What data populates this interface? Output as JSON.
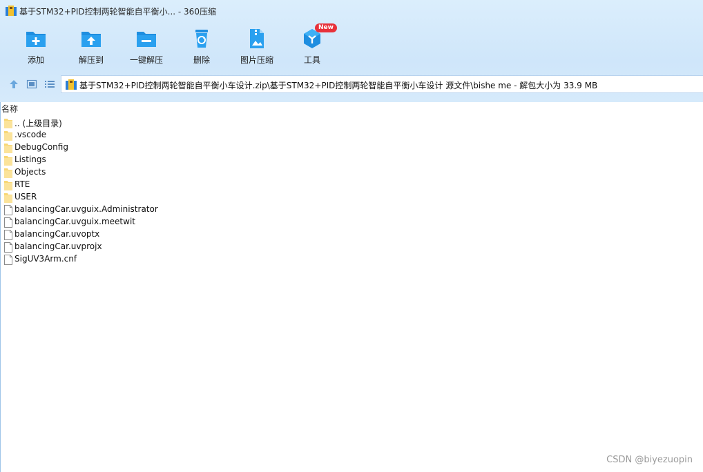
{
  "window": {
    "title": "基于STM32+PID控制两轮智能自平衡小... - 360压缩"
  },
  "toolbar": {
    "items": [
      {
        "label": "添加",
        "icon": "folder-add-icon"
      },
      {
        "label": "解压到",
        "icon": "folder-extract-icon"
      },
      {
        "label": "一键解压",
        "icon": "folder-minus-icon"
      },
      {
        "label": "删除",
        "icon": "recycle-bin-icon"
      },
      {
        "label": "图片压缩",
        "icon": "image-compress-icon"
      },
      {
        "label": "工具",
        "icon": "tools-cube-icon",
        "badge": "New"
      }
    ]
  },
  "nav": {
    "address": "基于STM32+PID控制两轮智能自平衡小车设计.zip\\基于STM32+PID控制两轮智能自平衡小车设计 源文件\\bishe me - 解包大小为 33.9 MB"
  },
  "list": {
    "column_name": "名称",
    "rows": [
      {
        "name": ".. (上级目录)",
        "type": "folder"
      },
      {
        "name": ".vscode",
        "type": "folder"
      },
      {
        "name": "DebugConfig",
        "type": "folder"
      },
      {
        "name": "Listings",
        "type": "folder"
      },
      {
        "name": "Objects",
        "type": "folder"
      },
      {
        "name": "RTE",
        "type": "folder"
      },
      {
        "name": "USER",
        "type": "folder"
      },
      {
        "name": "balancingCar.uvguix.Administrator",
        "type": "file"
      },
      {
        "name": "balancingCar.uvguix.meetwit",
        "type": "file"
      },
      {
        "name": "balancingCar.uvoptx",
        "type": "file"
      },
      {
        "name": "balancingCar.uvprojx",
        "type": "file"
      },
      {
        "name": "SigUV3Arm.cnf",
        "type": "file"
      }
    ]
  },
  "watermark": "CSDN @biyezuopin",
  "colors": {
    "accent": "#1e8ee0",
    "folder": "#f8d775",
    "badge": "#e8313a"
  }
}
